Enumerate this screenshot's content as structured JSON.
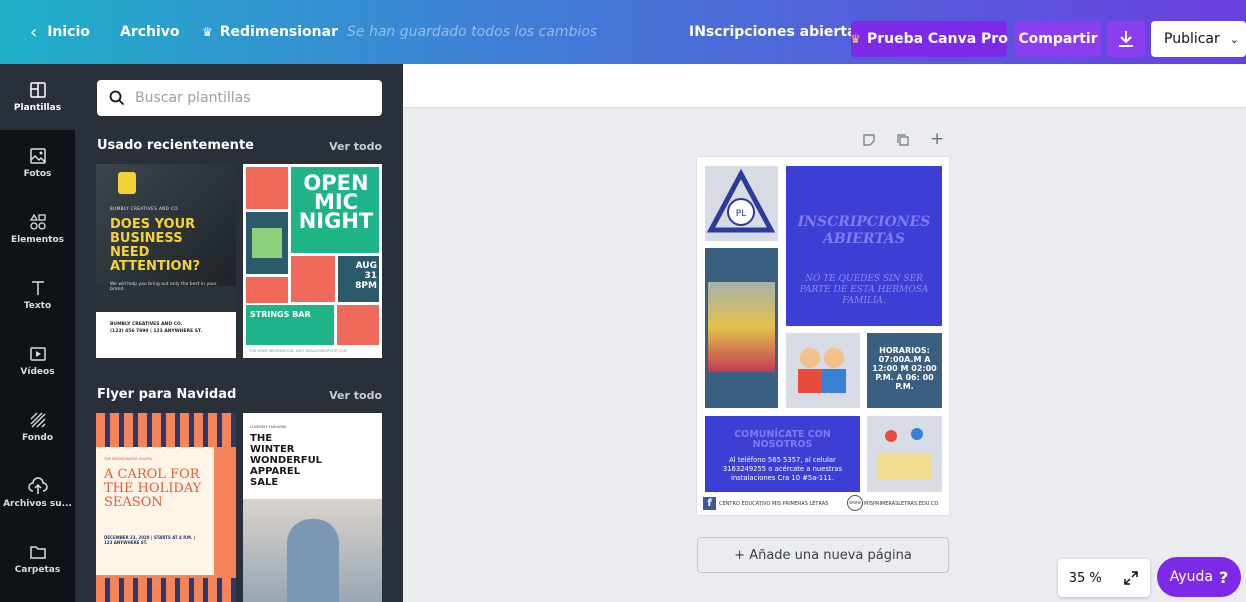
{
  "topbar": {
    "home": "Inicio",
    "file": "Archivo",
    "resize": "Redimensionar",
    "saved_status": "Se han guardado todos los cambios",
    "doc_title": "INscripciones abiertas",
    "try_pro": "Prueba Canva Pro",
    "share": "Compartir",
    "publish": "Publicar"
  },
  "rail": [
    {
      "label": "Plantillas",
      "icon": "templates-icon"
    },
    {
      "label": "Fotos",
      "icon": "photos-icon"
    },
    {
      "label": "Elementos",
      "icon": "elements-icon"
    },
    {
      "label": "Texto",
      "icon": "text-icon"
    },
    {
      "label": "Vídeos",
      "icon": "videos-icon"
    },
    {
      "label": "Fondo",
      "icon": "background-icon"
    },
    {
      "label": "Archivos su...",
      "icon": "uploads-icon"
    },
    {
      "label": "Carpetas",
      "icon": "folders-icon"
    }
  ],
  "panel": {
    "search_placeholder": "Buscar plantillas",
    "recent_title": "Usado recientemente",
    "recent_see_all": "Ver todo",
    "christmas_title": "Flyer para Navidad",
    "christmas_see_all": "Ver todo",
    "templates": {
      "business": {
        "brand": "BUMBLY CREATIVES AND CO.",
        "headline": "DOES YOUR BUSINESS NEED ATTENTION?",
        "sub": "We will help you bring out only the best in your brand.",
        "footer_name": "BUMBLY CREATIVES AND CO.",
        "footer_line": "(123) 456 7890 | 123 ANYWHERE ST."
      },
      "openmic": {
        "headline": "OPEN MIC NIGHT",
        "date": "AUG 31 8PM",
        "venue": "STRINGS BAR",
        "footer": "FOR MORE INFORMATION, VISIT REALLYGREATSITE.COM"
      },
      "carol": {
        "brand": "THE BRIDGEWATER CHAPEL",
        "headline": "A CAROL FOR THE HOLIDAY SEASON",
        "date_line": "DECEMBER 23, 2020 | STARTS AT 4 P.M. | 123 ANYWHERE ST."
      },
      "winter": {
        "brand": "LOVEDELY FASHIONS",
        "headline": "THE WINTER WONDERFUL APPAREL SALE"
      }
    }
  },
  "canvas": {
    "flyer": {
      "title": "INSCRIPCIONES ABIERTAS",
      "subtitle": "NO TE QUEDES SIN SER PARTE DE ESTA HERMOSA FAMILIA.",
      "hours": "HORARIOS: 07:00A.M A 12:00 M 02:00 P.M. A 06: 00 P.M.",
      "contact_title": "COMUNÍCATE CON NOSOTROS",
      "contact_body": "Al teléfono 565 5357, al celular 3163249255 o acércate a nuestras instalaciones Cra 10 #5a-111.",
      "footer_left": "CENTRO EDUCATIVO MIS PRIMERAS LETRAS",
      "footer_right": "MISPRIMERASLETRAS.EDU.CO"
    },
    "add_page": "+ Añade una nueva página"
  },
  "zoom": {
    "level": "35 %"
  },
  "help": {
    "label": "Ayuda",
    "mark": "?"
  },
  "colors": {
    "accent": "#7d2ae8",
    "flyer_blue": "#3c3fd3",
    "flyer_slate": "#3b5f80"
  }
}
